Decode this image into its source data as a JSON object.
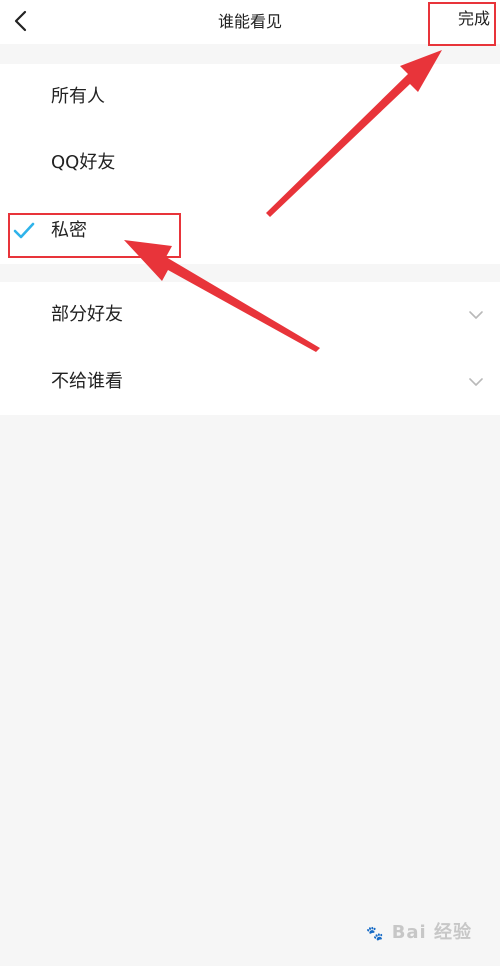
{
  "header": {
    "back_icon": "chevron-left-icon",
    "title": "谁能看见",
    "done_label": "完成"
  },
  "privacy_options": [
    {
      "label": "所有人",
      "selected": false
    },
    {
      "label": "QQ好友",
      "selected": false
    },
    {
      "label": "私密",
      "selected": true
    }
  ],
  "group_options": [
    {
      "label": "部分好友",
      "icon": "chevron-down-icon"
    },
    {
      "label": "不给谁看",
      "icon": "chevron-down-icon"
    }
  ],
  "colors": {
    "accent_check": "#2fb3ea",
    "annotation_red": "#e8343a",
    "background": "#f6f6f6"
  },
  "watermark": {
    "text": "Bai 经验",
    "icon": "baidu-paw-icon"
  }
}
